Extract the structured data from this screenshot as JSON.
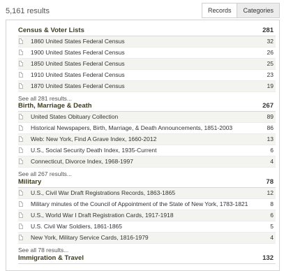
{
  "header": {
    "results_count": "5,161 results",
    "tabs": [
      {
        "label": "Records",
        "active": false
      },
      {
        "label": "Categories",
        "active": true
      }
    ]
  },
  "colors": {
    "section_title": "#3d3d1e",
    "alt_row_bg": "#f3f3ef",
    "active_tab_bg": "#ececec"
  },
  "sections": [
    {
      "title": "Census & Voter Lists",
      "count": "281",
      "items": [
        {
          "label": "1860 United States Federal Census",
          "count": "32",
          "icon": "document-icon"
        },
        {
          "label": "1900 United States Federal Census",
          "count": "26",
          "icon": "document-icon"
        },
        {
          "label": "1850 United States Federal Census",
          "count": "25",
          "icon": "document-icon"
        },
        {
          "label": "1910 United States Federal Census",
          "count": "23",
          "icon": "document-icon"
        },
        {
          "label": "1870 United States Federal Census",
          "count": "19",
          "icon": "document-icon"
        }
      ],
      "see_all": "See all 281 results..."
    },
    {
      "title": "Birth, Marriage & Death",
      "count": "267",
      "items": [
        {
          "label": "United States Obituary Collection",
          "count": "89",
          "icon": "document-icon"
        },
        {
          "label": "Historical Newspapers, Birth, Marriage, & Death Announcements, 1851-2003",
          "count": "86",
          "icon": "document-icon"
        },
        {
          "label": "Web: New York, Find A Grave Index, 1660-2012",
          "count": "13",
          "icon": "document-icon"
        },
        {
          "label": "U.S., Social Security Death Index, 1935-Current",
          "count": "6",
          "icon": "document-icon"
        },
        {
          "label": "Connecticut, Divorce Index, 1968-1997",
          "count": "4",
          "icon": "document-icon"
        }
      ],
      "see_all": "See all 267 results..."
    },
    {
      "title": "Military",
      "count": "78",
      "items": [
        {
          "label": "U.S., Civil War Draft Registrations Records, 1863-1865",
          "count": "12",
          "icon": "document-icon"
        },
        {
          "label": "Military minutes of the Council of Appointment of the State of New York, 1783-1821",
          "count": "8",
          "icon": "document-icon"
        },
        {
          "label": "U.S., World War I Draft Registration Cards, 1917-1918",
          "count": "6",
          "icon": "document-icon"
        },
        {
          "label": "U.S. Civil War Soldiers, 1861-1865",
          "count": "5",
          "icon": "document-icon"
        },
        {
          "label": "New York, Military Service Cards, 1816-1979",
          "count": "4",
          "icon": "document-icon"
        }
      ],
      "see_all": "See all 78 results..."
    },
    {
      "title": "Immigration & Travel",
      "count": "132",
      "items": [],
      "see_all": ""
    }
  ]
}
